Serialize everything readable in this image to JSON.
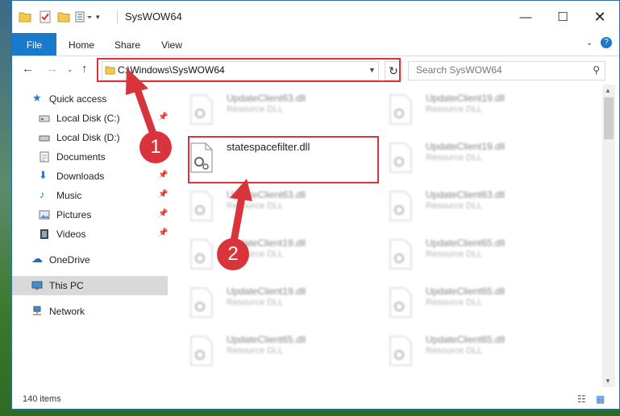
{
  "window": {
    "title": "SysWOW64"
  },
  "ribbon": {
    "tabs": [
      "File",
      "Home",
      "Share",
      "View"
    ]
  },
  "address": {
    "path": "C:\\Windows\\SysWOW64"
  },
  "search": {
    "placeholder": "Search SysWOW64"
  },
  "sidebar": {
    "items": [
      {
        "label": "Quick access",
        "icon": "star-icon"
      },
      {
        "label": "Local Disk (C:)",
        "icon": "drive-icon"
      },
      {
        "label": "Local Disk (D:)",
        "icon": "drive-icon"
      },
      {
        "label": "Documents",
        "icon": "documents-icon"
      },
      {
        "label": "Downloads",
        "icon": "download-icon"
      },
      {
        "label": "Music",
        "icon": "music-icon"
      },
      {
        "label": "Pictures",
        "icon": "pictures-icon"
      },
      {
        "label": "Videos",
        "icon": "videos-icon"
      },
      {
        "label": "OneDrive",
        "icon": "cloud-icon"
      },
      {
        "label": "This PC",
        "icon": "computer-icon"
      },
      {
        "label": "Network",
        "icon": "network-icon"
      }
    ]
  },
  "files": {
    "highlighted": {
      "name": "statespacefilter.dll"
    },
    "left": [
      {
        "name": "UpdateClient63.dll",
        "type": "Resource DLL"
      },
      {
        "name": "UpdateClient63.dll",
        "type": "Resource DLL"
      },
      {
        "name": "UpdateClient19.dll",
        "type": "Resource DLL"
      },
      {
        "name": "UpdateClient19.dll",
        "type": "Resource DLL"
      },
      {
        "name": "UpdateClient65.dll",
        "type": "Resource DLL"
      }
    ],
    "right": [
      {
        "name": "UpdateClient19.dll",
        "type": "Resource DLL"
      },
      {
        "name": "UpdateClient19.dll",
        "type": "Resource DLL"
      },
      {
        "name": "UpdateClient63.dll",
        "type": "Resource DLL"
      },
      {
        "name": "UpdateClient65.dll",
        "type": "Resource DLL"
      },
      {
        "name": "UpdateClient65.dll",
        "type": "Resource DLL"
      },
      {
        "name": "UpdateClient65.dll",
        "type": "Resource DLL"
      }
    ]
  },
  "status": {
    "count": "140 items"
  },
  "callouts": [
    "1",
    "2"
  ],
  "colors": {
    "accent": "#1979ca",
    "annotation": "#d9343b"
  }
}
